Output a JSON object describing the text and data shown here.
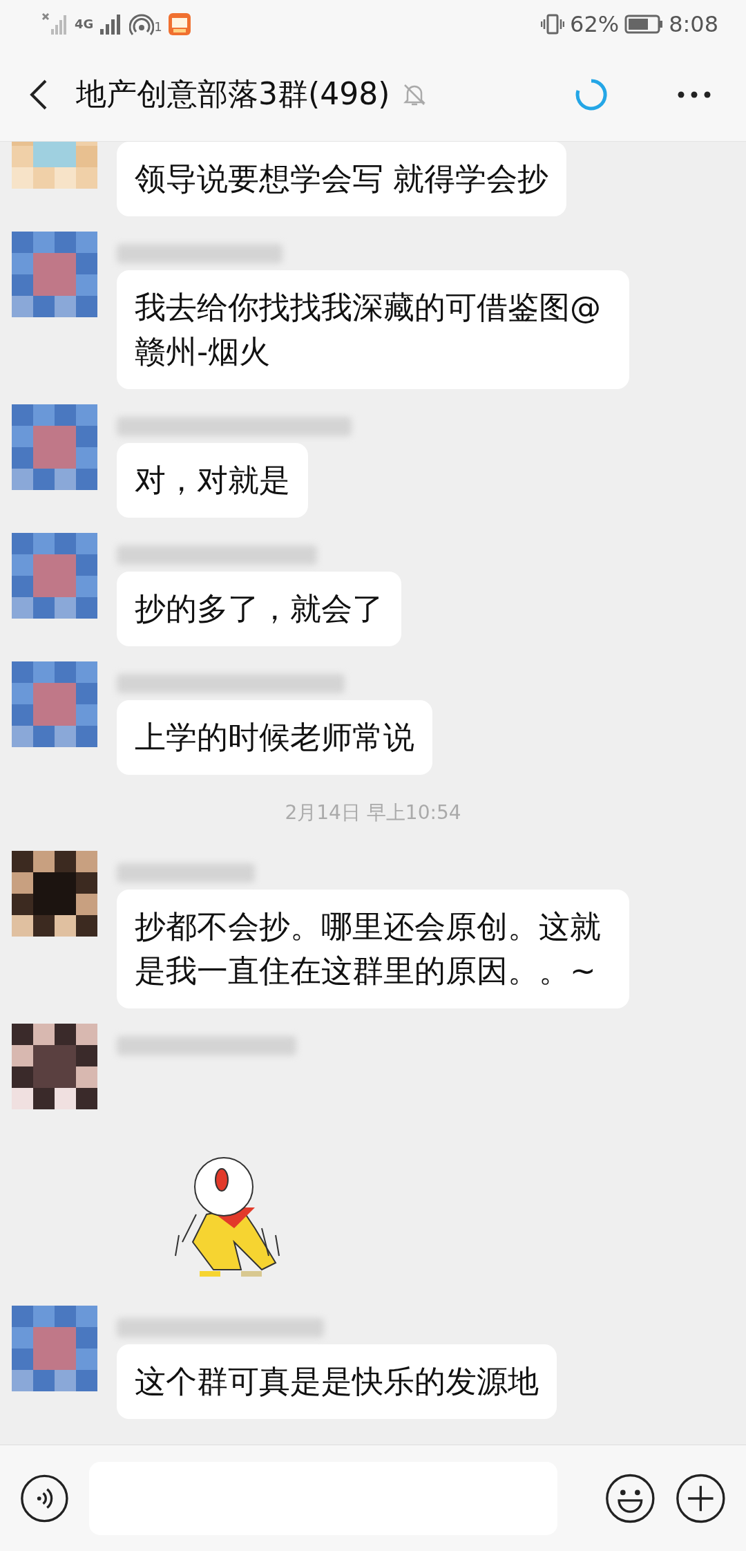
{
  "status_bar": {
    "network": "4G",
    "hotspot_count": "1",
    "battery": "62%",
    "time": "8:08"
  },
  "header": {
    "title": "地产创意部落3群(498)"
  },
  "messages": [
    {
      "kind": "text",
      "text": "领导说要想学会写 就得学会抄"
    },
    {
      "kind": "text",
      "text": "我去给你找找我深藏的可借鉴图@赣州-烟火"
    },
    {
      "kind": "text",
      "text": "对，对就是"
    },
    {
      "kind": "text",
      "text": "抄的多了，就会了"
    },
    {
      "kind": "text",
      "text": "上学的时候老师常说"
    },
    {
      "kind": "time",
      "text": "2月14日 早上10:54"
    },
    {
      "kind": "text",
      "text": "抄都不会抄。哪里还会原创。这就是我一直住在这群里的原因。。~"
    },
    {
      "kind": "sticker"
    },
    {
      "kind": "text",
      "text": "这个群可真是是快乐的发源地"
    }
  ]
}
